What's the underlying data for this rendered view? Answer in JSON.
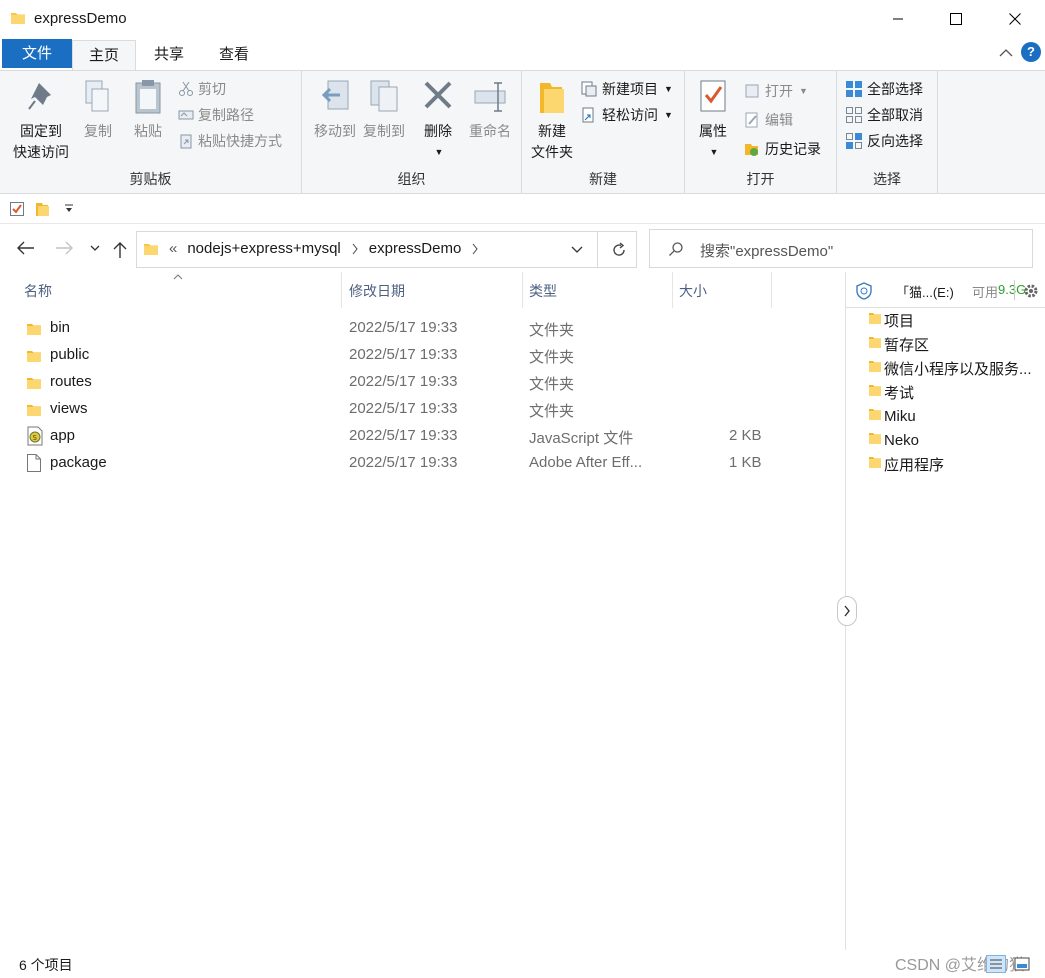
{
  "window": {
    "title": "expressDemo"
  },
  "tabs": {
    "file": "文件",
    "home": "主页",
    "share": "共享",
    "view": "查看",
    "help": "?"
  },
  "ribbon": {
    "clipboard": {
      "pin_line1": "固定到",
      "pin_line2": "快速访问",
      "copy": "复制",
      "paste": "粘贴",
      "cut": "剪切",
      "copy_path": "复制路径",
      "paste_shortcut": "粘贴快捷方式",
      "label": "剪贴板"
    },
    "organize": {
      "move_to": "移动到",
      "copy_to": "复制到",
      "delete": "删除",
      "rename": "重命名",
      "label": "组织"
    },
    "new": {
      "new_folder_line1": "新建",
      "new_folder_line2": "文件夹",
      "new_item": "新建项目",
      "easy_access": "轻松访问",
      "label": "新建"
    },
    "open": {
      "properties": "属性",
      "open": "打开",
      "edit": "编辑",
      "history": "历史记录",
      "label": "打开"
    },
    "select": {
      "select_all": "全部选择",
      "select_none": "全部取消",
      "invert": "反向选择",
      "label": "选择"
    }
  },
  "address": {
    "overflow": "«",
    "crumbs": [
      "nodejs+express+mysql",
      "expressDemo"
    ]
  },
  "search": {
    "placeholder": "搜索\"expressDemo\""
  },
  "columns": {
    "name": "名称",
    "date": "修改日期",
    "type": "类型",
    "size": "大小"
  },
  "files": [
    {
      "name": "bin",
      "date": "2022/5/17 19:33",
      "type": "文件夹",
      "size": "",
      "icon": "folder-icon"
    },
    {
      "name": "public",
      "date": "2022/5/17 19:33",
      "type": "文件夹",
      "size": "",
      "icon": "folder-icon"
    },
    {
      "name": "routes",
      "date": "2022/5/17 19:33",
      "type": "文件夹",
      "size": "",
      "icon": "folder-icon"
    },
    {
      "name": "views",
      "date": "2022/5/17 19:33",
      "type": "文件夹",
      "size": "",
      "icon": "folder-icon"
    },
    {
      "name": "app",
      "date": "2022/5/17 19:33",
      "type": "JavaScript 文件",
      "size": "2 KB",
      "icon": "js-file-icon"
    },
    {
      "name": "package",
      "date": "2022/5/17 19:33",
      "type": "Adobe After Eff...",
      "size": "1 KB",
      "icon": "file-icon"
    }
  ],
  "side_panel": {
    "drive_label": "「猫...(E:)",
    "free_label": "可用",
    "free_value": "9.3G",
    "items": [
      "项目",
      "暂存区",
      "微信小程序以及服务...",
      "考试",
      "Miku",
      "Neko",
      "应用程序"
    ]
  },
  "status": {
    "count": "6 个项目"
  },
  "watermark": "CSDN @艾维的猫",
  "colors": {
    "accent": "#1b6fc2",
    "folder": "#f8c64a",
    "free_space": "#2e9d2e"
  }
}
